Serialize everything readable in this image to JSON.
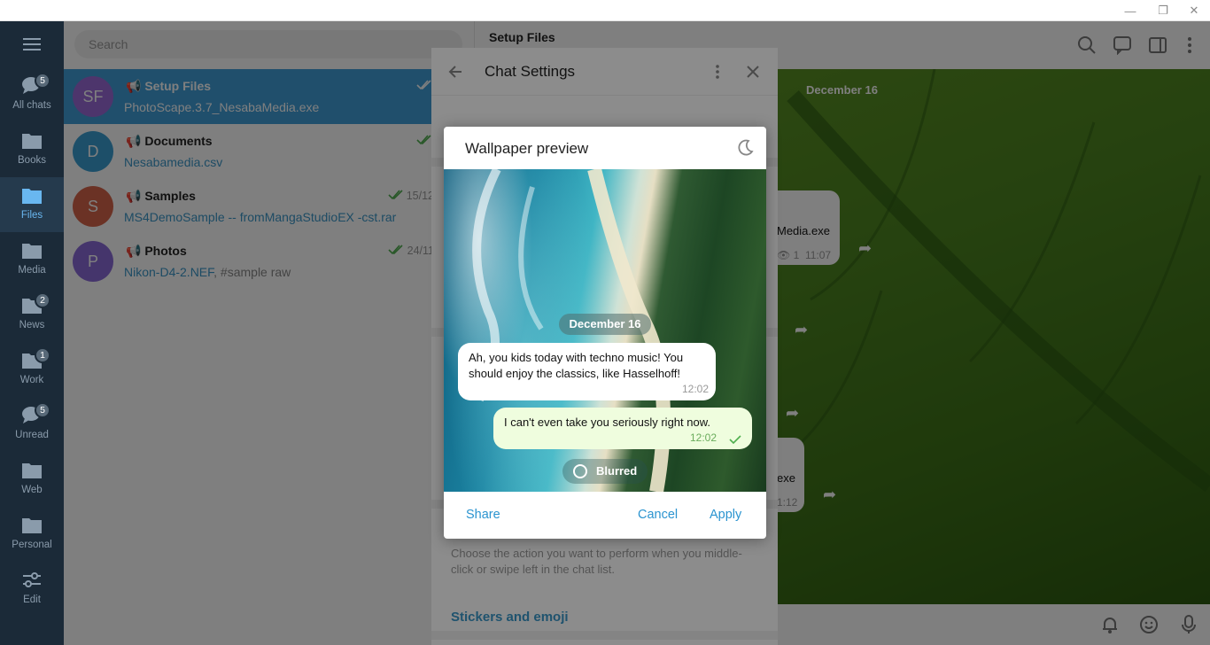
{
  "window": {
    "minimize": "—",
    "restore": "❐",
    "close": "✕"
  },
  "rail": {
    "folders": [
      {
        "label": "All chats",
        "badge": "5"
      },
      {
        "label": "Books",
        "badge": ""
      },
      {
        "label": "Files",
        "badge": ""
      },
      {
        "label": "Media",
        "badge": ""
      },
      {
        "label": "News",
        "badge": "2"
      },
      {
        "label": "Work",
        "badge": "1"
      },
      {
        "label": "Unread",
        "badge": "5"
      },
      {
        "label": "Web",
        "badge": ""
      },
      {
        "label": "Personal",
        "badge": ""
      },
      {
        "label": "Edit",
        "badge": ""
      }
    ]
  },
  "chatlist": {
    "search_placeholder": "Search",
    "chats": [
      {
        "initials": "SF",
        "name": "Setup Files",
        "sub": "PhotoScape.3.7_NesabaMedia.exe",
        "sub_extra": "",
        "date": "",
        "color": "#9a6ad8"
      },
      {
        "initials": "D",
        "name": "Documents",
        "sub": "Nesabamedia.csv",
        "sub_extra": "",
        "date": "",
        "color": "#3a9ed3"
      },
      {
        "initials": "S",
        "name": "Samples",
        "sub": "MS4DemoSample -- fromMangaStudioEX -cst.rar",
        "sub_extra": "",
        "date": "15/12",
        "color": "#d7644a"
      },
      {
        "initials": "P",
        "name": "Photos",
        "sub": "Nikon-D4-2.NEF",
        "sub_extra": ", #sample raw",
        "date": "24/11",
        "color": "#8a6ad8"
      }
    ]
  },
  "conversation": {
    "title": "Setup Files",
    "date": "December 16",
    "msg1_text": "Media.exe",
    "msg1_views": "1",
    "msg1_time": "11:07",
    "msg2_text": "exe",
    "msg2_time": "1:12"
  },
  "settings": {
    "title": "Chat Settings",
    "description": "Choose the action you want to perform when you middle-click or swipe left in the chat list.",
    "section": "Stickers and emoji",
    "swatches": [
      "#2f95d4",
      "#3a97c9",
      "#4cae4c",
      "#d4549a",
      "#e0852c",
      "#8c5ec9",
      "#d04545",
      "#5a6a80",
      "#e0b020"
    ]
  },
  "dialog": {
    "title": "Wallpaper preview",
    "date_pill": "December 16",
    "incoming_text": "Ah, you kids today with techno music! You should enjoy the classics, like Hasselhoff!",
    "incoming_time": "12:02",
    "outgoing_text": "I can't even take you seriously right now.",
    "outgoing_time": "12:02",
    "blur_label": "Blurred",
    "share_label": "Share",
    "cancel_label": "Cancel",
    "apply_label": "Apply"
  }
}
